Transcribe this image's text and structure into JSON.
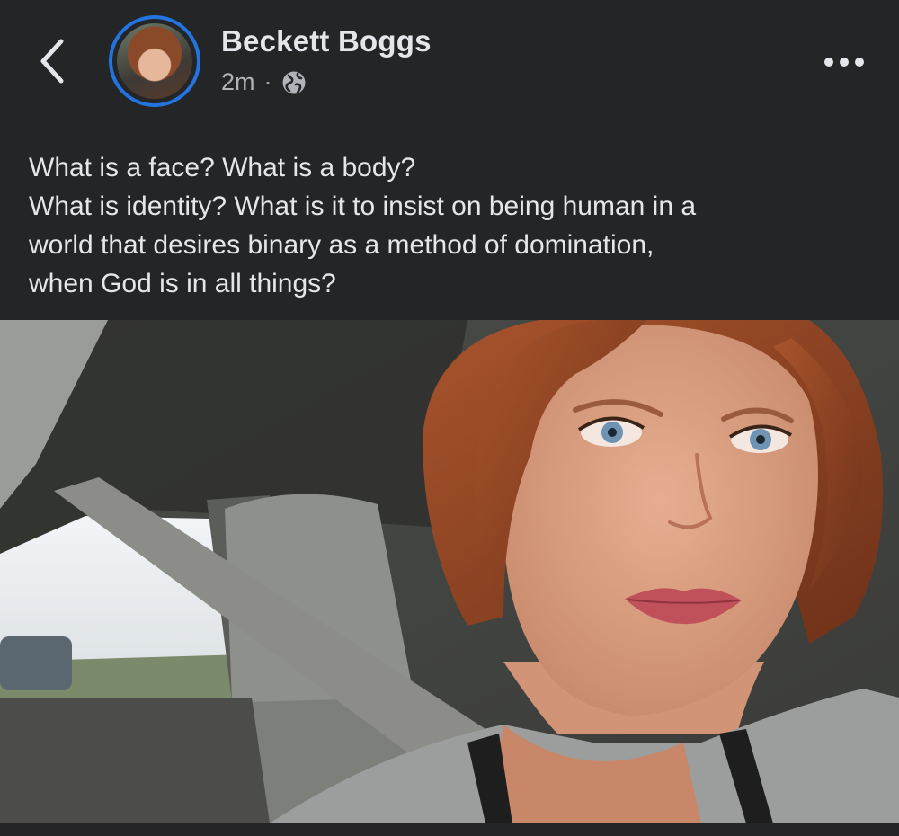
{
  "post": {
    "author_name": "Beckett Boggs",
    "timestamp": "2m",
    "separator": "·",
    "audience_icon": "globe-icon",
    "caption_lines": [
      "What is a face? What is a body?",
      "What is identity? What is it to insist on being human in a",
      "world that desires binary as a method of domination,",
      "when God is in all things?"
    ]
  },
  "icons": {
    "back": "chevron-left-icon",
    "more": "more-horizontal-icon",
    "audience": "globe-icon"
  },
  "colors": {
    "background": "#242526",
    "text_primary": "#e4e6eb",
    "text_secondary": "#b0b3b8",
    "avatar_ring": "#2374e1"
  }
}
